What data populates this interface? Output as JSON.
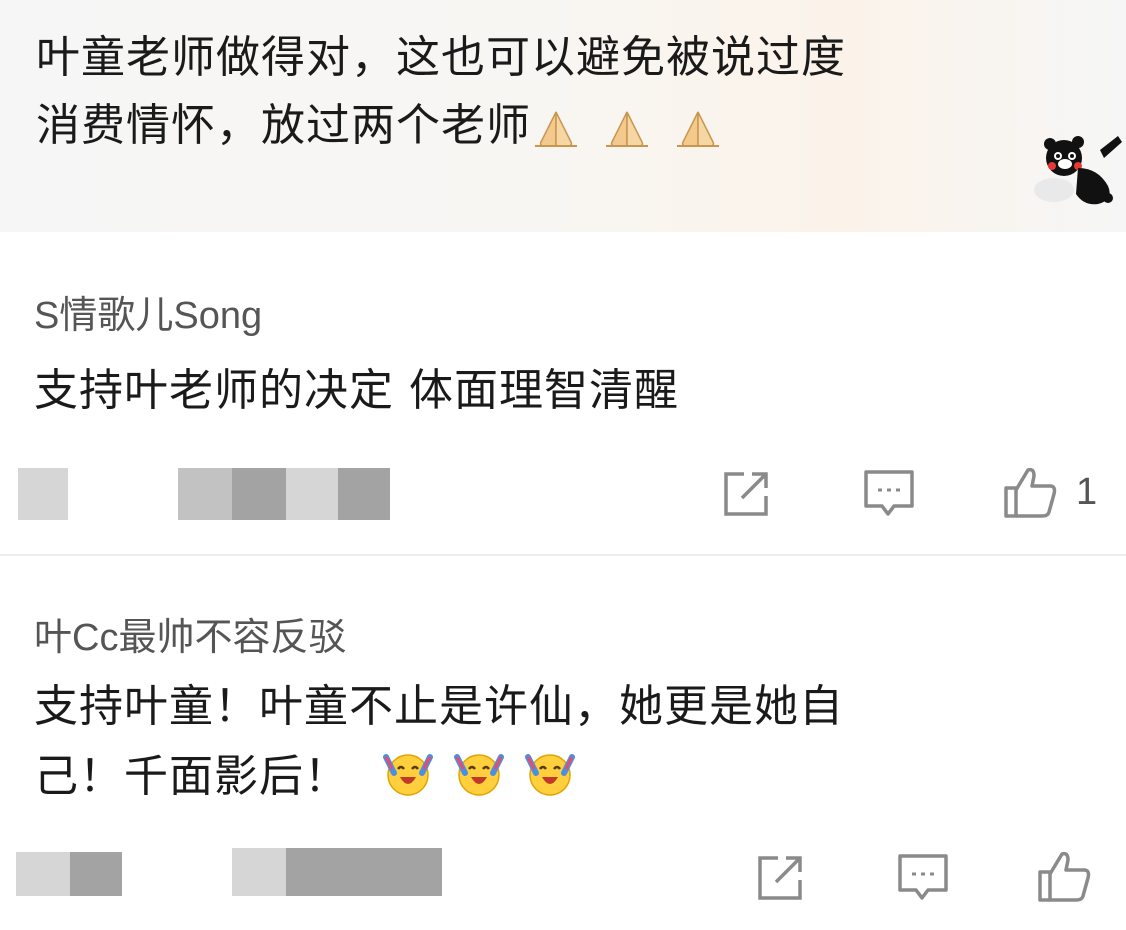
{
  "top_comment": {
    "text_line1": "叶童老师做得对，这也可以避免被说过度",
    "text_line2": "消费情怀，放过两个老师",
    "emoji_icon": "praying-hands-emoji",
    "emoji_count": 3,
    "sticker_icon": "kumamon-sticker"
  },
  "comments": [
    {
      "username": "S情歌儿Song",
      "text": "支持叶老师的决定 体面理智清醒",
      "actions": {
        "share_icon": "share-icon",
        "comment_icon": "comment-icon",
        "like_icon": "thumbs-up-icon",
        "like_count": "1"
      }
    },
    {
      "username": "叶Cc最帅不容反驳",
      "text_line1": "支持叶童！叶童不止是许仙，她更是她自",
      "text_line2": "己！千面影后！",
      "emoji_icon": "cheering-face-emoji",
      "emoji_count": 3,
      "actions": {
        "share_icon": "share-icon",
        "comment_icon": "comment-icon",
        "like_icon": "thumbs-up-icon"
      }
    }
  ],
  "colors": {
    "text": "#1a1a1a",
    "username": "#555555",
    "icon": "#8a8a8a",
    "divider": "#ededed"
  }
}
